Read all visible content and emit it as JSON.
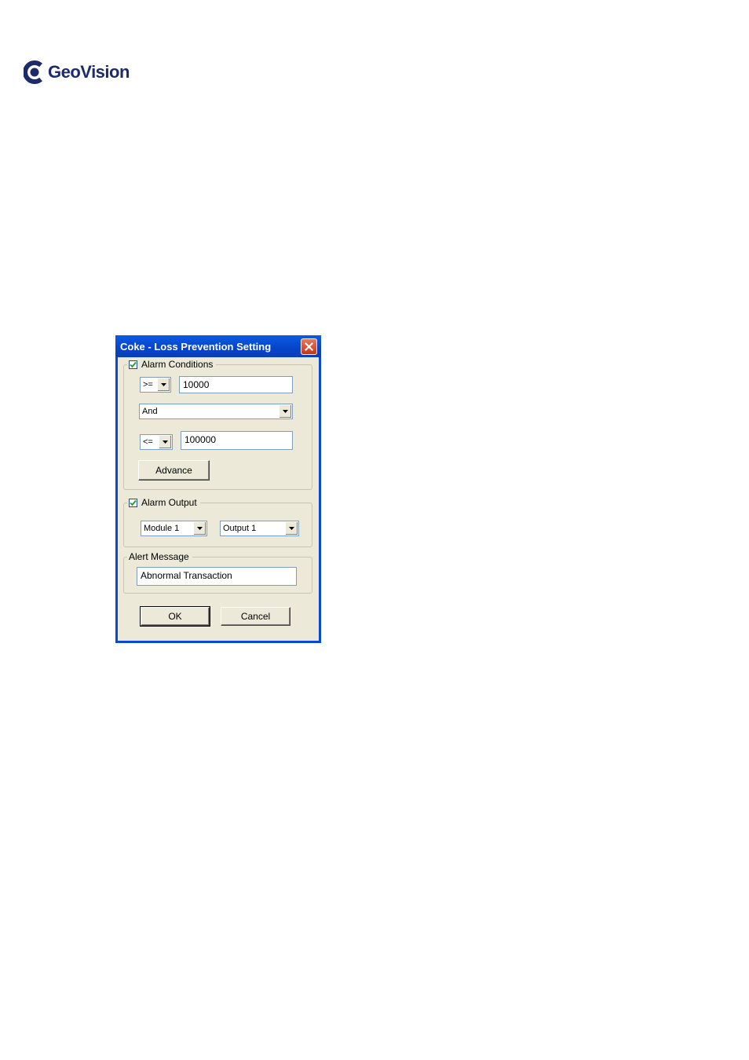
{
  "logo": {
    "brand": "GeoVision",
    "mark": "GeoVision logo"
  },
  "dialog": {
    "title": "Coke - Loss Prevention Setting",
    "alarm_conditions": {
      "label": "Alarm Conditions",
      "checked": true,
      "operator1": ">=",
      "value1": "10000",
      "logic": "And",
      "operator2": "<=",
      "value2": "100000",
      "advance_label": "Advance"
    },
    "alarm_output": {
      "label": "Alarm Output",
      "checked": true,
      "module": "Module 1",
      "output": "Output 1"
    },
    "alert_message": {
      "label": "Alert Message",
      "value": "Abnormal Transaction"
    },
    "ok_label": "OK",
    "cancel_label": "Cancel"
  }
}
